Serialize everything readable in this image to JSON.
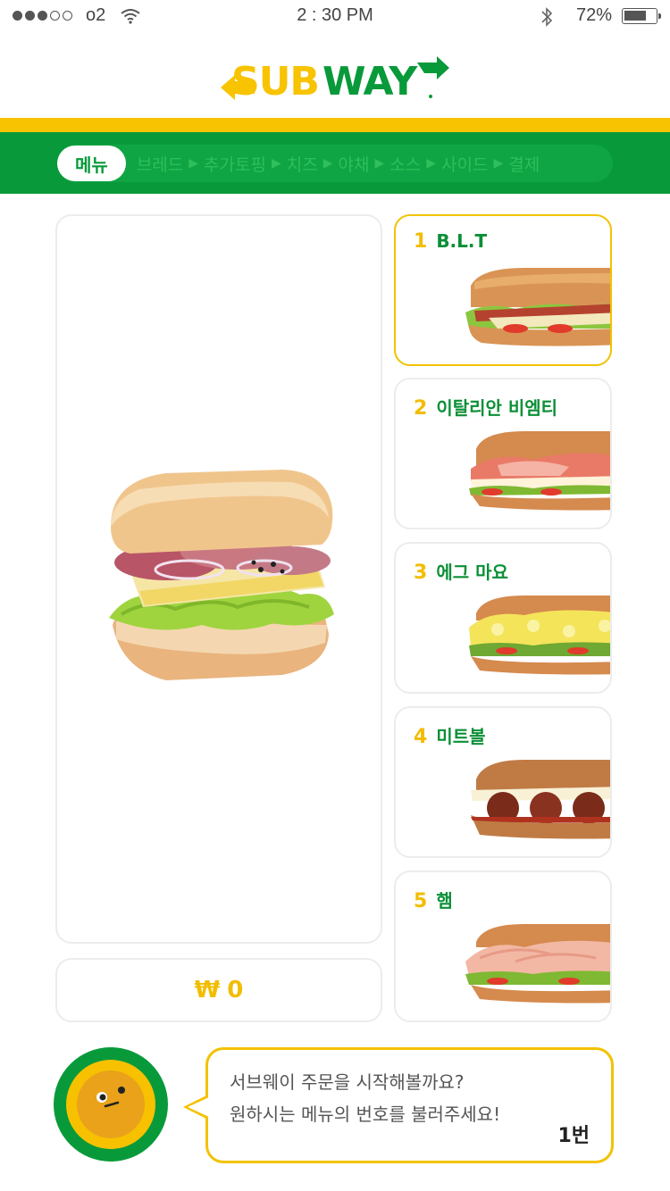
{
  "status_bar": {
    "signal_dots": [
      true,
      true,
      true,
      false,
      false
    ],
    "carrier": "o2",
    "time": "2 : 30 PM",
    "battery": "72%",
    "battery_level": 0.72
  },
  "brand": {
    "logo_text": "SUBWAY",
    "colors": {
      "green": "#089a3a",
      "yellow": "#f8c300"
    }
  },
  "steps_nav": {
    "active": "메뉴",
    "steps": [
      "브레드",
      "추가토핑",
      "치즈",
      "야채",
      "소스",
      "사이드",
      "결제"
    ]
  },
  "preview": {
    "price_currency": "₩",
    "price_value": "0"
  },
  "menu": [
    {
      "number": "1",
      "name": "B.L.T",
      "selected": true
    },
    {
      "number": "2",
      "name": "이탈리안 비엠티",
      "selected": false
    },
    {
      "number": "3",
      "name": "에그 마요",
      "selected": false
    },
    {
      "number": "4",
      "name": "미트볼",
      "selected": false
    },
    {
      "number": "5",
      "name": "햄",
      "selected": false
    }
  ],
  "assistant": {
    "line1": "서브웨이 주문을 시작해볼까요?",
    "line2": "원하시는 메뉴의 번호를 불러주세요!",
    "answer": "1번"
  }
}
